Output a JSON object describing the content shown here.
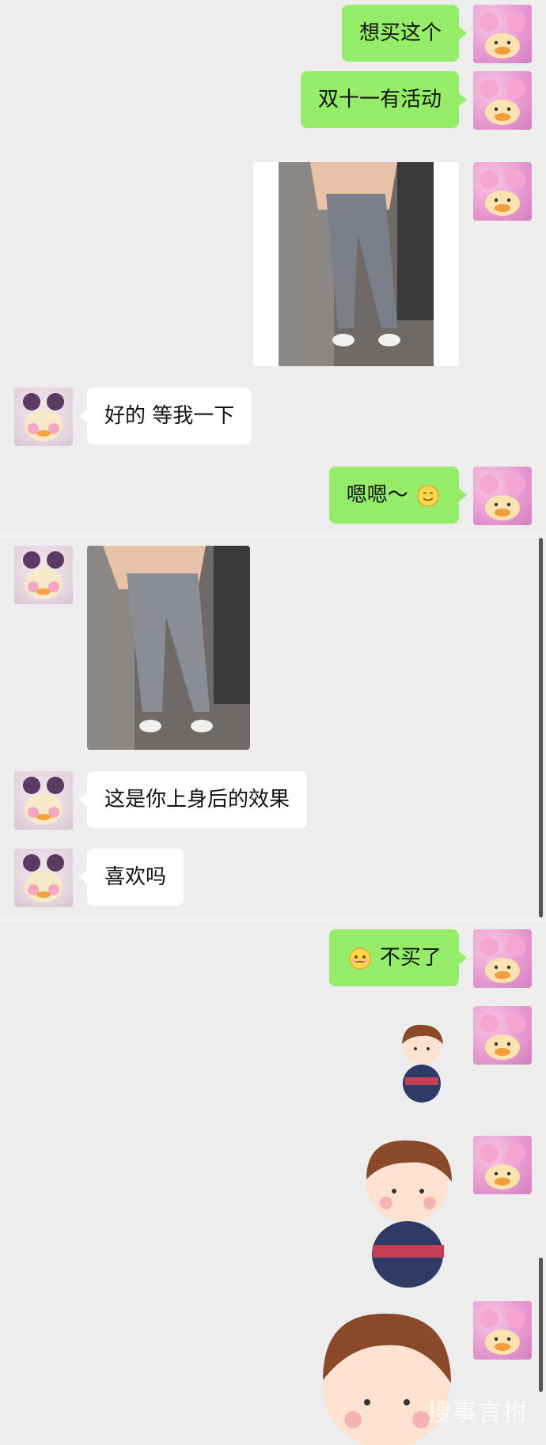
{
  "messages": {
    "m1": {
      "text": "想买这个"
    },
    "m2": {
      "text": "双十一有活动"
    },
    "m4": {
      "text": "好的 等我一下"
    },
    "m5": {
      "text": "嗯嗯～"
    },
    "m7": {
      "text": "这是你上身后的效果"
    },
    "m8": {
      "text": "喜欢吗"
    },
    "m9": {
      "text": "不买了"
    }
  },
  "watermark": {
    "text": "搜事言拊"
  },
  "colors": {
    "background": "#ededed",
    "sent_bubble": "#95ec69",
    "received_bubble": "#ffffff",
    "text": "#111111"
  },
  "icons": {
    "smile": "smile-emoji-icon",
    "awkward": "awkward-emoji-icon",
    "avatar_self": "pink-duck-avatar",
    "avatar_other": "purple-duck-avatar"
  }
}
